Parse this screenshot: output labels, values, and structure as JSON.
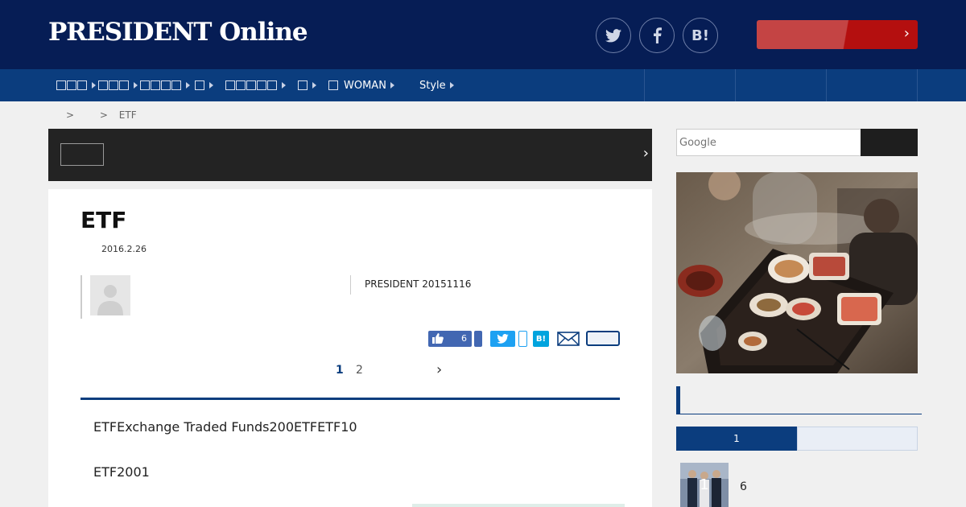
{
  "header": {
    "logo": "PRESIDENT Online",
    "social": {
      "twitter": "twitter-icon",
      "facebook": "facebook-icon",
      "hatena": "B!"
    }
  },
  "nav": {
    "items": [
      {
        "label": "",
        "glyphs": 3
      },
      {
        "label": "",
        "glyphs": 3
      },
      {
        "label": "",
        "glyphs": 4
      },
      {
        "label": "",
        "glyphs": 1
      },
      {
        "label": "",
        "glyphs": 5
      },
      {
        "label": "",
        "glyphs": 1
      },
      {
        "label": "WOMAN",
        "glyphs": 1
      },
      {
        "label": "Style",
        "glyphs": 0
      }
    ]
  },
  "breadcrumb": {
    "sep1": ">",
    "sep2": ">",
    "current": "ETF"
  },
  "article": {
    "title": "ETF",
    "date": "2016.2.26",
    "magazine": "PRESIDENT 20151116",
    "like_count": "6",
    "hatena": "B!",
    "pagination": {
      "current": "1",
      "next_page": "2"
    },
    "paragraphs": [
      "ETFExchange Traded Funds200ETFETF10",
      "ETF2001"
    ]
  },
  "sidebar": {
    "search_placeholder": "Google",
    "ranking": {
      "tab_active": "1",
      "items": [
        {
          "rank": "1",
          "text": "6"
        }
      ]
    }
  },
  "colors": {
    "header_bg": "#061d55",
    "nav_bg": "#0b3d7e",
    "accent_red": "#b40f0f",
    "facebook_blue": "#4267b2",
    "twitter_blue": "#1da1f2"
  }
}
